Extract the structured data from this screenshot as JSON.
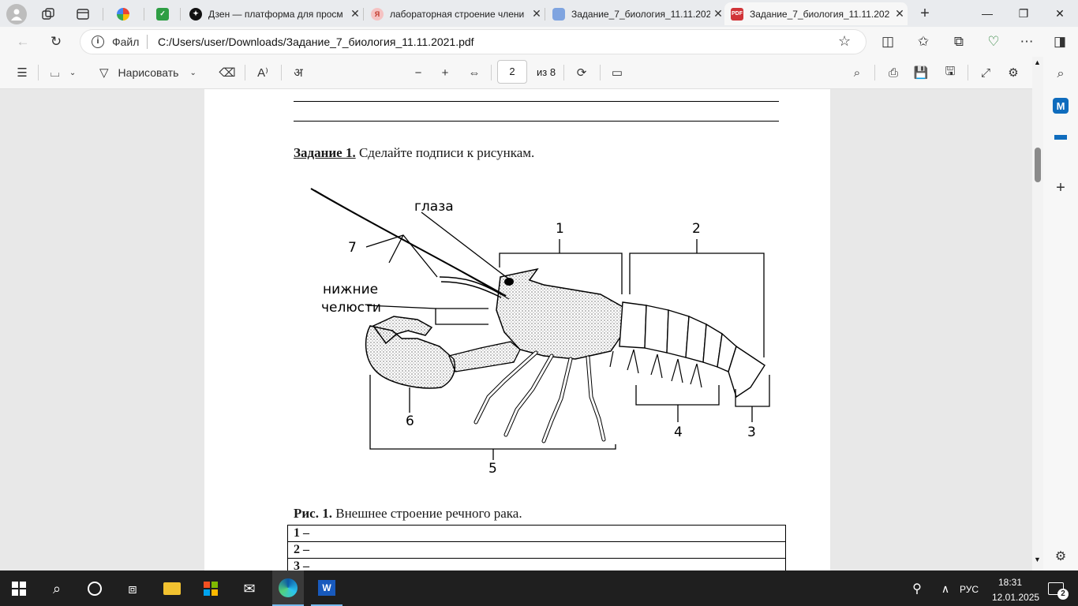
{
  "browser": {
    "tabs": [
      {
        "title": "",
        "favicon": "workspaces-icon"
      },
      {
        "title": "",
        "favicon": "google-tab-icon"
      },
      {
        "title": "",
        "favicon": "leaf-tab-icon"
      },
      {
        "title": "Дзен — платформа для просм",
        "favicon": "dzen-icon"
      },
      {
        "title": "лабораторная строение члени",
        "favicon": "yandex-icon"
      },
      {
        "title": "Задание_7_биология_11.11.202",
        "favicon": "pdf-icon"
      },
      {
        "title": "Задание_7_биология_11.11.202",
        "favicon": "pdf-icon",
        "active": true
      }
    ],
    "address": {
      "scheme_label": "Файл",
      "url": "C:/Users/user/Downloads/Задание_7_биология_11.11.2021.pdf"
    }
  },
  "pdf_toolbar": {
    "draw_label": "Нарисовать",
    "page_current": "2",
    "page_total_label": "из 8"
  },
  "document": {
    "task_heading": "Задание 1.",
    "task_text": " Сделайте подписи к рисункам.",
    "figure_labels": {
      "eyes": "глаза",
      "lower_jaws_line1": "нижние",
      "lower_jaws_line2": "челюсти",
      "n1": "1",
      "n2": "2",
      "n3": "3",
      "n4": "4",
      "n5": "5",
      "n6": "6",
      "n7": "7"
    },
    "caption_bold": "Рис. 1.",
    "caption_text": " Внешнее строение речного рака.",
    "answer_rows": [
      "1 –",
      "2 –",
      "3 –"
    ]
  },
  "taskbar": {
    "language": "РУС",
    "time": "18:31",
    "date": "12.01.2025",
    "notification_count": "2"
  },
  "colors": {
    "accent_edge": "#0f6cbd",
    "taskbar_bg": "#1f1f1f",
    "pdf_red": "#d13438"
  }
}
